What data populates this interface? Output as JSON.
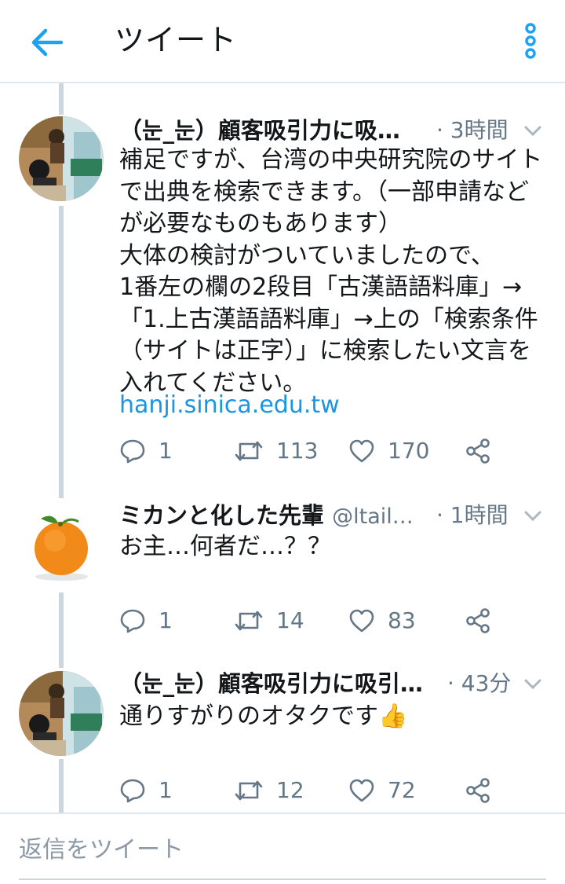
{
  "header": {
    "title": "ツイート",
    "back_icon": "arrow-left-icon",
    "more_icon": "vertical-dots-icon",
    "accent_color": "#1da1f2"
  },
  "tweets": [
    {
      "name": "（눈_눈）顧客吸引力に吸…",
      "handle": "",
      "time": "· 3時間",
      "text": "補足ですが、台湾の中央研究院のサイトで出典を検索できます。（一部申請などが必要なものもあります）\n大体の検討がついていましたので、\n1番左の欄の2段目「古漢語語料庫」→「1.上古漢語語料庫」→上の「検索条件（サイトは正字）」に検索したい文言を入れてください。",
      "link": "hanji.sinica.edu.tw",
      "replies": "1",
      "retweets": "113",
      "likes": "170"
    },
    {
      "name": "ミカンと化した先輩",
      "handle": "@ltail…",
      "time": "· 1時間",
      "text": "お主…何者だ…？？",
      "replies": "1",
      "retweets": "14",
      "likes": "83"
    },
    {
      "name": "（눈_눈）顧客吸引力に吸引…",
      "handle": "",
      "time": "· 43分",
      "text": "通りすがりのオタクです👍",
      "replies": "1",
      "retweets": "12",
      "likes": "72"
    }
  ],
  "reply_bar": {
    "placeholder": "返信をツイート"
  }
}
